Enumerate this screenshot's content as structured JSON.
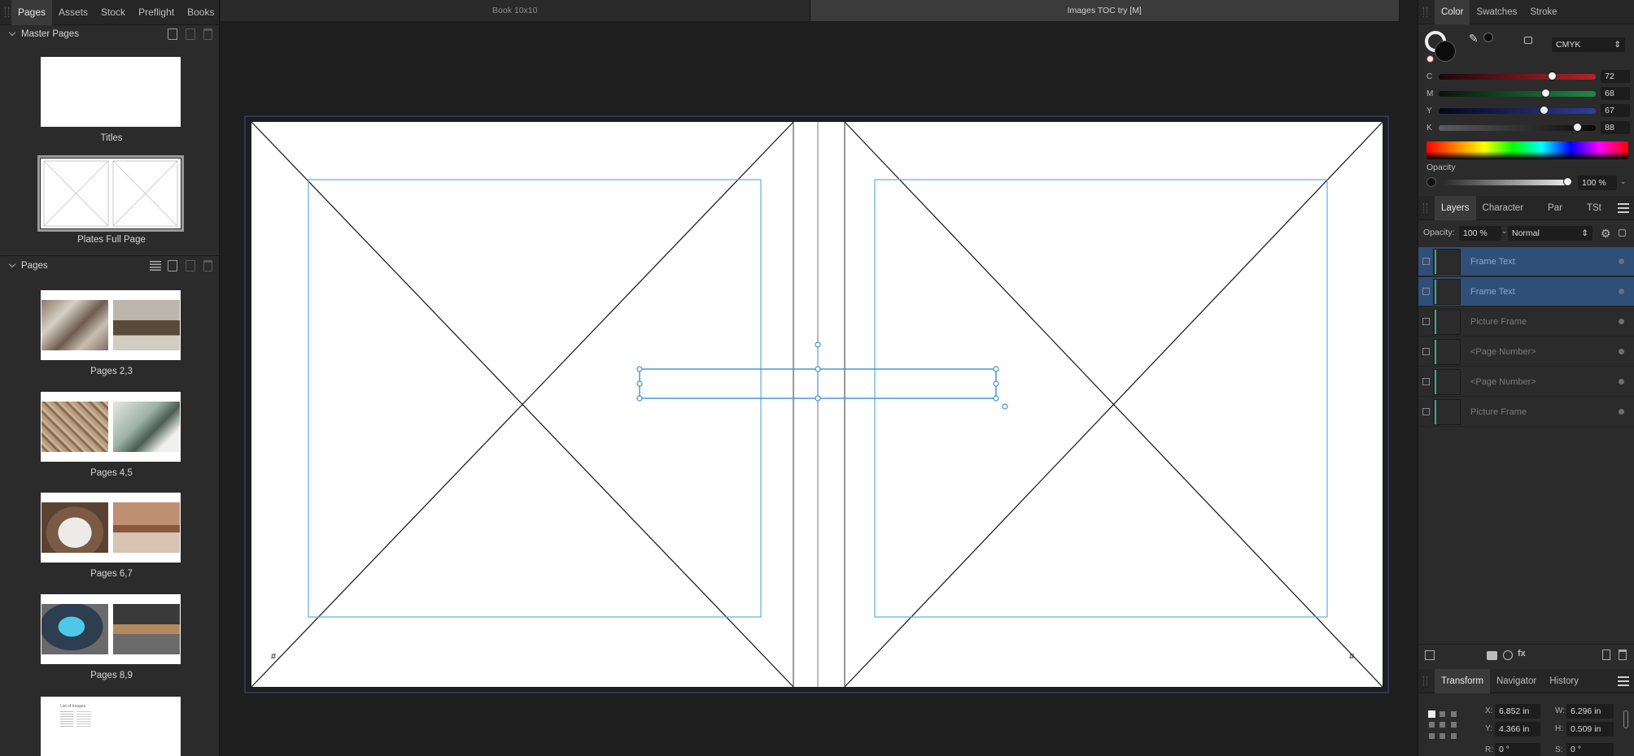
{
  "left_panel": {
    "tabs": [
      "Pages",
      "Assets",
      "Stock",
      "Preflight",
      "Books"
    ],
    "active_tab": "Pages",
    "master_pages": {
      "title": "Master Pages",
      "items": [
        {
          "label": "Titles"
        },
        {
          "label": "Plates Full Page"
        }
      ]
    },
    "pages": {
      "title": "Pages",
      "items": [
        {
          "label": "Pages 2,3"
        },
        {
          "label": "Pages 4,5"
        },
        {
          "label": "Pages 6,7"
        },
        {
          "label": "Pages 8,9"
        },
        {
          "label": ""
        }
      ],
      "last_thumb_text": "List of Images"
    }
  },
  "document_tabs": [
    {
      "label": "Book 10x10",
      "active": false
    },
    {
      "label": "Images TOC try [M]",
      "active": true
    }
  ],
  "canvas": {
    "page_number_marker_left": "#",
    "page_number_marker_right": "#"
  },
  "color_panel": {
    "tabs": [
      "Color",
      "Swatches",
      "Stroke"
    ],
    "active_tab": "Color",
    "model": "CMYK",
    "channels": [
      {
        "label": "C",
        "value": "72",
        "fraction": 0.72
      },
      {
        "label": "M",
        "value": "68",
        "fraction": 0.68
      },
      {
        "label": "Y",
        "value": "67",
        "fraction": 0.67
      },
      {
        "label": "K",
        "value": "88",
        "fraction": 0.88
      }
    ],
    "opacity_label": "Opacity",
    "opacity_value": "100 %",
    "opacity_fraction": 1.0
  },
  "layers_panel": {
    "tabs": [
      "Layers",
      "Character",
      "Par",
      "TSt"
    ],
    "active_tab": "Layers",
    "opacity_label": "Opacity:",
    "opacity_value": "100 %",
    "blend_mode": "Normal",
    "layers": [
      {
        "name": "Frame Text",
        "selected": true
      },
      {
        "name": "Frame Text",
        "selected": true
      },
      {
        "name": "Picture Frame",
        "selected": false
      },
      {
        "name": "<Page Number>",
        "selected": false
      },
      {
        "name": "<Page Number>",
        "selected": false
      },
      {
        "name": "Picture Frame",
        "selected": false
      }
    ]
  },
  "transform_panel": {
    "tabs": [
      "Transform",
      "Navigator",
      "History"
    ],
    "active_tab": "Transform",
    "x_label": "X:",
    "x_value": "6.852 in",
    "y_label": "Y:",
    "y_value": "4.366 in",
    "w_label": "W:",
    "w_value": "6.296 in",
    "h_label": "H:",
    "h_value": "0.509 in",
    "r_label": "R:",
    "r_value": "0 °",
    "s_label": "S:",
    "s_value": "0 °"
  },
  "colors": {
    "accent": "#4a8fd6",
    "selection_row": "#2f4f78",
    "guide": "#3e9bdb"
  }
}
